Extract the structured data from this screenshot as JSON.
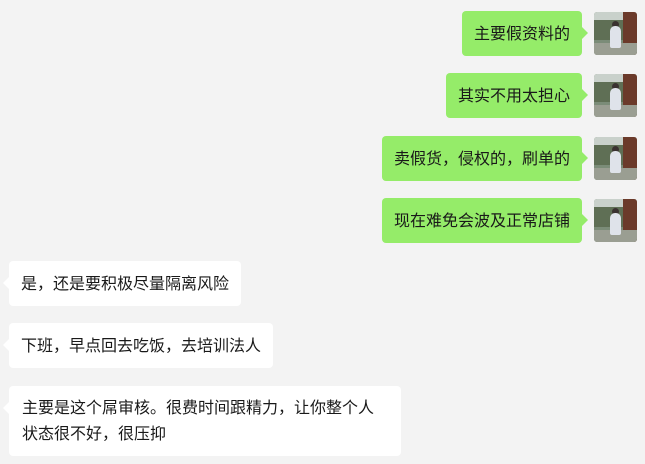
{
  "messages": [
    {
      "sender": "self",
      "text": "主要假资料的"
    },
    {
      "sender": "self",
      "text": "其实不用太担心"
    },
    {
      "sender": "self",
      "text": "卖假货，侵权的，刷单的"
    },
    {
      "sender": "self",
      "text": "现在难免会波及正常店铺"
    },
    {
      "sender": "other",
      "text": "是，还是要积极尽量隔离风险"
    },
    {
      "sender": "other",
      "text": "下班，早点回去吃饭，去培训法人"
    },
    {
      "sender": "other",
      "text": "主要是这个屌审核。很费时间跟精力，让你整个人状态很不好，很压抑"
    }
  ],
  "colors": {
    "background": "#f3f3f3",
    "self_bubble": "#95ec69",
    "other_bubble": "#ffffff",
    "text": "#191919"
  },
  "icons": {
    "self_avatar": "user-photo-avatar"
  }
}
